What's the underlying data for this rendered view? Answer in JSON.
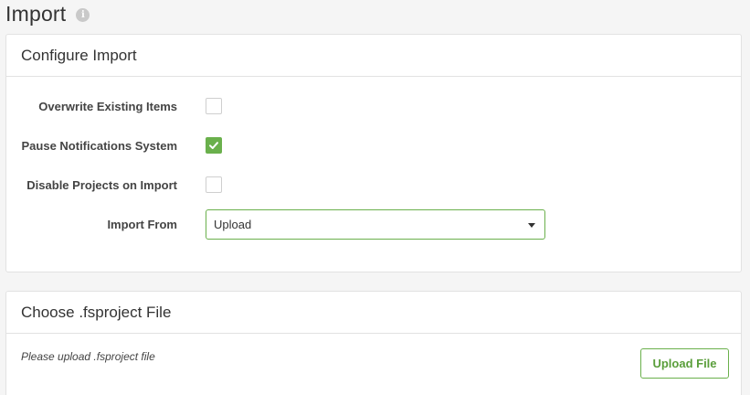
{
  "page": {
    "title": "Import",
    "info_icon": "info-icon"
  },
  "configure_panel": {
    "heading": "Configure Import",
    "fields": [
      {
        "label": "Overwrite Existing Items",
        "type": "checkbox",
        "checked": false
      },
      {
        "label": "Pause Notifications System",
        "type": "checkbox",
        "checked": true
      },
      {
        "label": "Disable Projects on Import",
        "type": "checkbox",
        "checked": false
      },
      {
        "label": "Import From",
        "type": "select",
        "value": "Upload"
      }
    ]
  },
  "file_panel": {
    "heading": "Choose .fsproject File",
    "note": "Please upload .fsproject file",
    "upload_button": "Upload File"
  },
  "colors": {
    "accent": "#6ab04c",
    "border": "#e2e2e2",
    "background": "#f5f5f5"
  }
}
